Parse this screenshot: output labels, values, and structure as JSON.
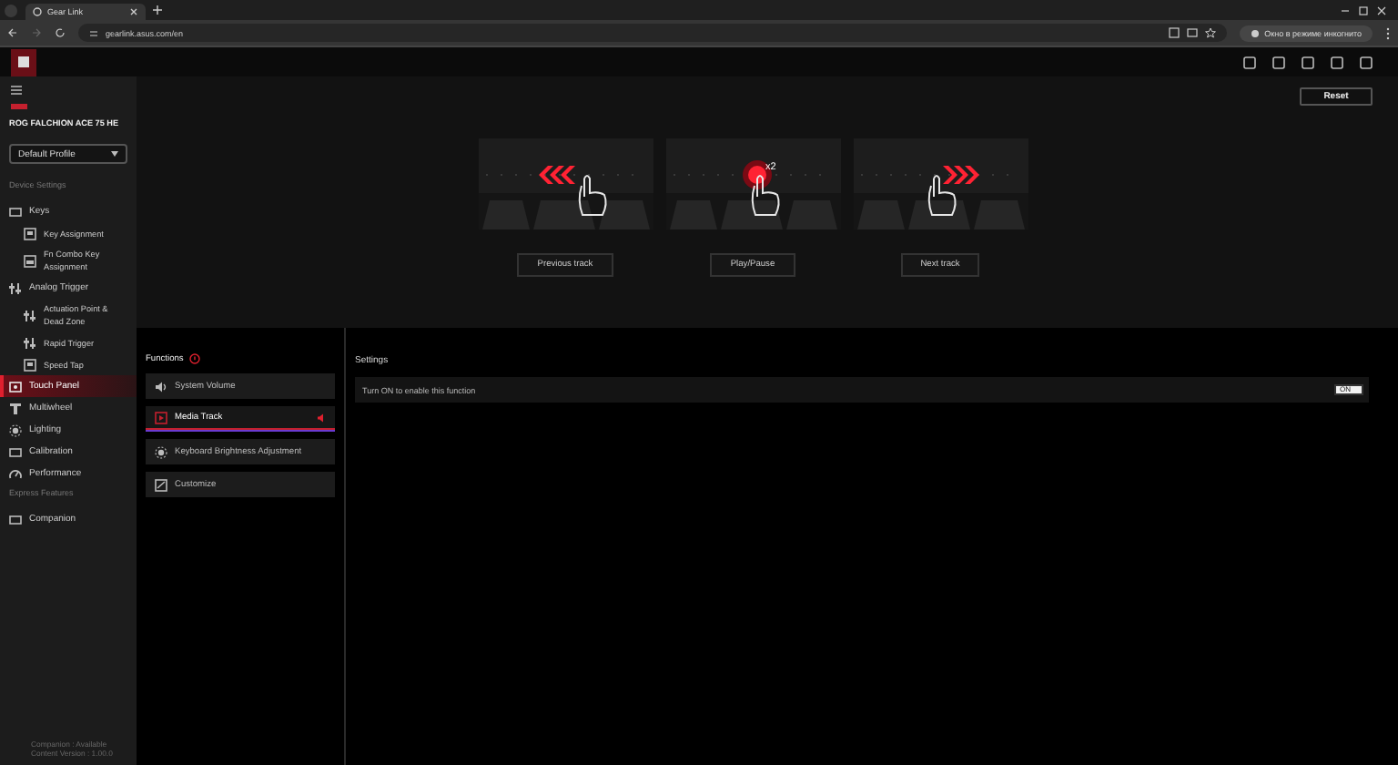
{
  "browser": {
    "tab_title": "Gear Link",
    "url": "gearlink.asus.com/en",
    "profile_label": "Окно в режиме инкогнито"
  },
  "sidebar": {
    "device_name": "ROG FALCHION ACE 75 HE",
    "profile": "Default Profile",
    "sections": [
      {
        "title": "Device Settings",
        "items": [
          {
            "label": "Keys",
            "selected": false,
            "children": [
              {
                "label": "Key Assignment",
                "selected": false
              },
              {
                "label": "Fn Combo Key Assignment",
                "selected": false
              }
            ]
          },
          {
            "label": "Analog Trigger",
            "selected": false,
            "children": [
              {
                "label": "Actuation Point & Dead Zone",
                "selected": false
              },
              {
                "label": "Rapid Trigger",
                "selected": false
              },
              {
                "label": "Speed Tap",
                "selected": false
              }
            ]
          },
          {
            "label": "Touch Panel",
            "selected": true
          },
          {
            "label": "Multiwheel",
            "selected": false
          },
          {
            "label": "Lighting",
            "selected": false
          },
          {
            "label": "Calibration",
            "selected": false
          },
          {
            "label": "Performance",
            "selected": false
          }
        ]
      },
      {
        "title": "Express Features",
        "items": [
          {
            "label": "Companion",
            "selected": false
          }
        ]
      }
    ],
    "footer": [
      "Companion : Available",
      "Content Version : 1.00.0"
    ]
  },
  "reset_button": "Reset",
  "gestures": [
    {
      "kind": "swipe_left",
      "label": "Previous track"
    },
    {
      "kind": "double_tap",
      "label": "Play/Pause",
      "badge": "x2"
    },
    {
      "kind": "swipe_right",
      "label": "Next track"
    }
  ],
  "functions": {
    "title": "Functions",
    "items": [
      {
        "label": "System Volume",
        "selected": false
      },
      {
        "label": "Media Track",
        "selected": true
      },
      {
        "label": "Keyboard Brightness Adjustment",
        "selected": false
      },
      {
        "label": "Customize",
        "selected": false
      }
    ]
  },
  "settings": {
    "title": "Settings",
    "rows": [
      {
        "label": "Turn ON to enable this function",
        "toggle_label": "ON",
        "on": true
      }
    ]
  }
}
